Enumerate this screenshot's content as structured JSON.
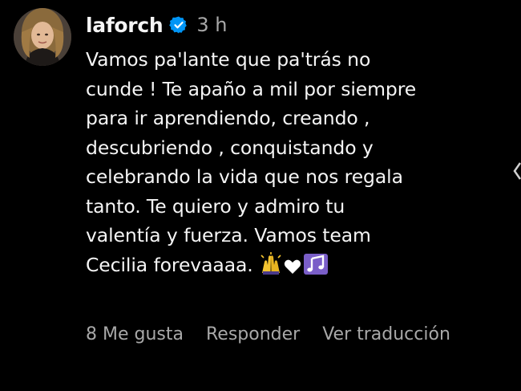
{
  "comment": {
    "username": "laforch",
    "time": "3 h",
    "text_lines": [
      "Vamos pa'lante que pa'trás no",
      "cunde ! Te apaño a mil por siempre",
      "para ir aprendiendo, creando ,",
      "descubriendo , conquistando y",
      "celebrando la vida que nos regala",
      "tanto. Te quiero y admiro tu",
      "valentía y fuerza. Vamos team",
      "Cecilia forevaaaa."
    ],
    "emojis": [
      "raising-hands-emoji",
      "white-heart-emoji",
      "music-notes-emoji"
    ],
    "actions": {
      "likes": "8 Me gusta",
      "reply": "Responder",
      "translate": "Ver traducción"
    }
  },
  "colors": {
    "background": "#000000",
    "text": "#f5f5f5",
    "secondary": "#a8a8a8",
    "verified": "#0095f6"
  }
}
